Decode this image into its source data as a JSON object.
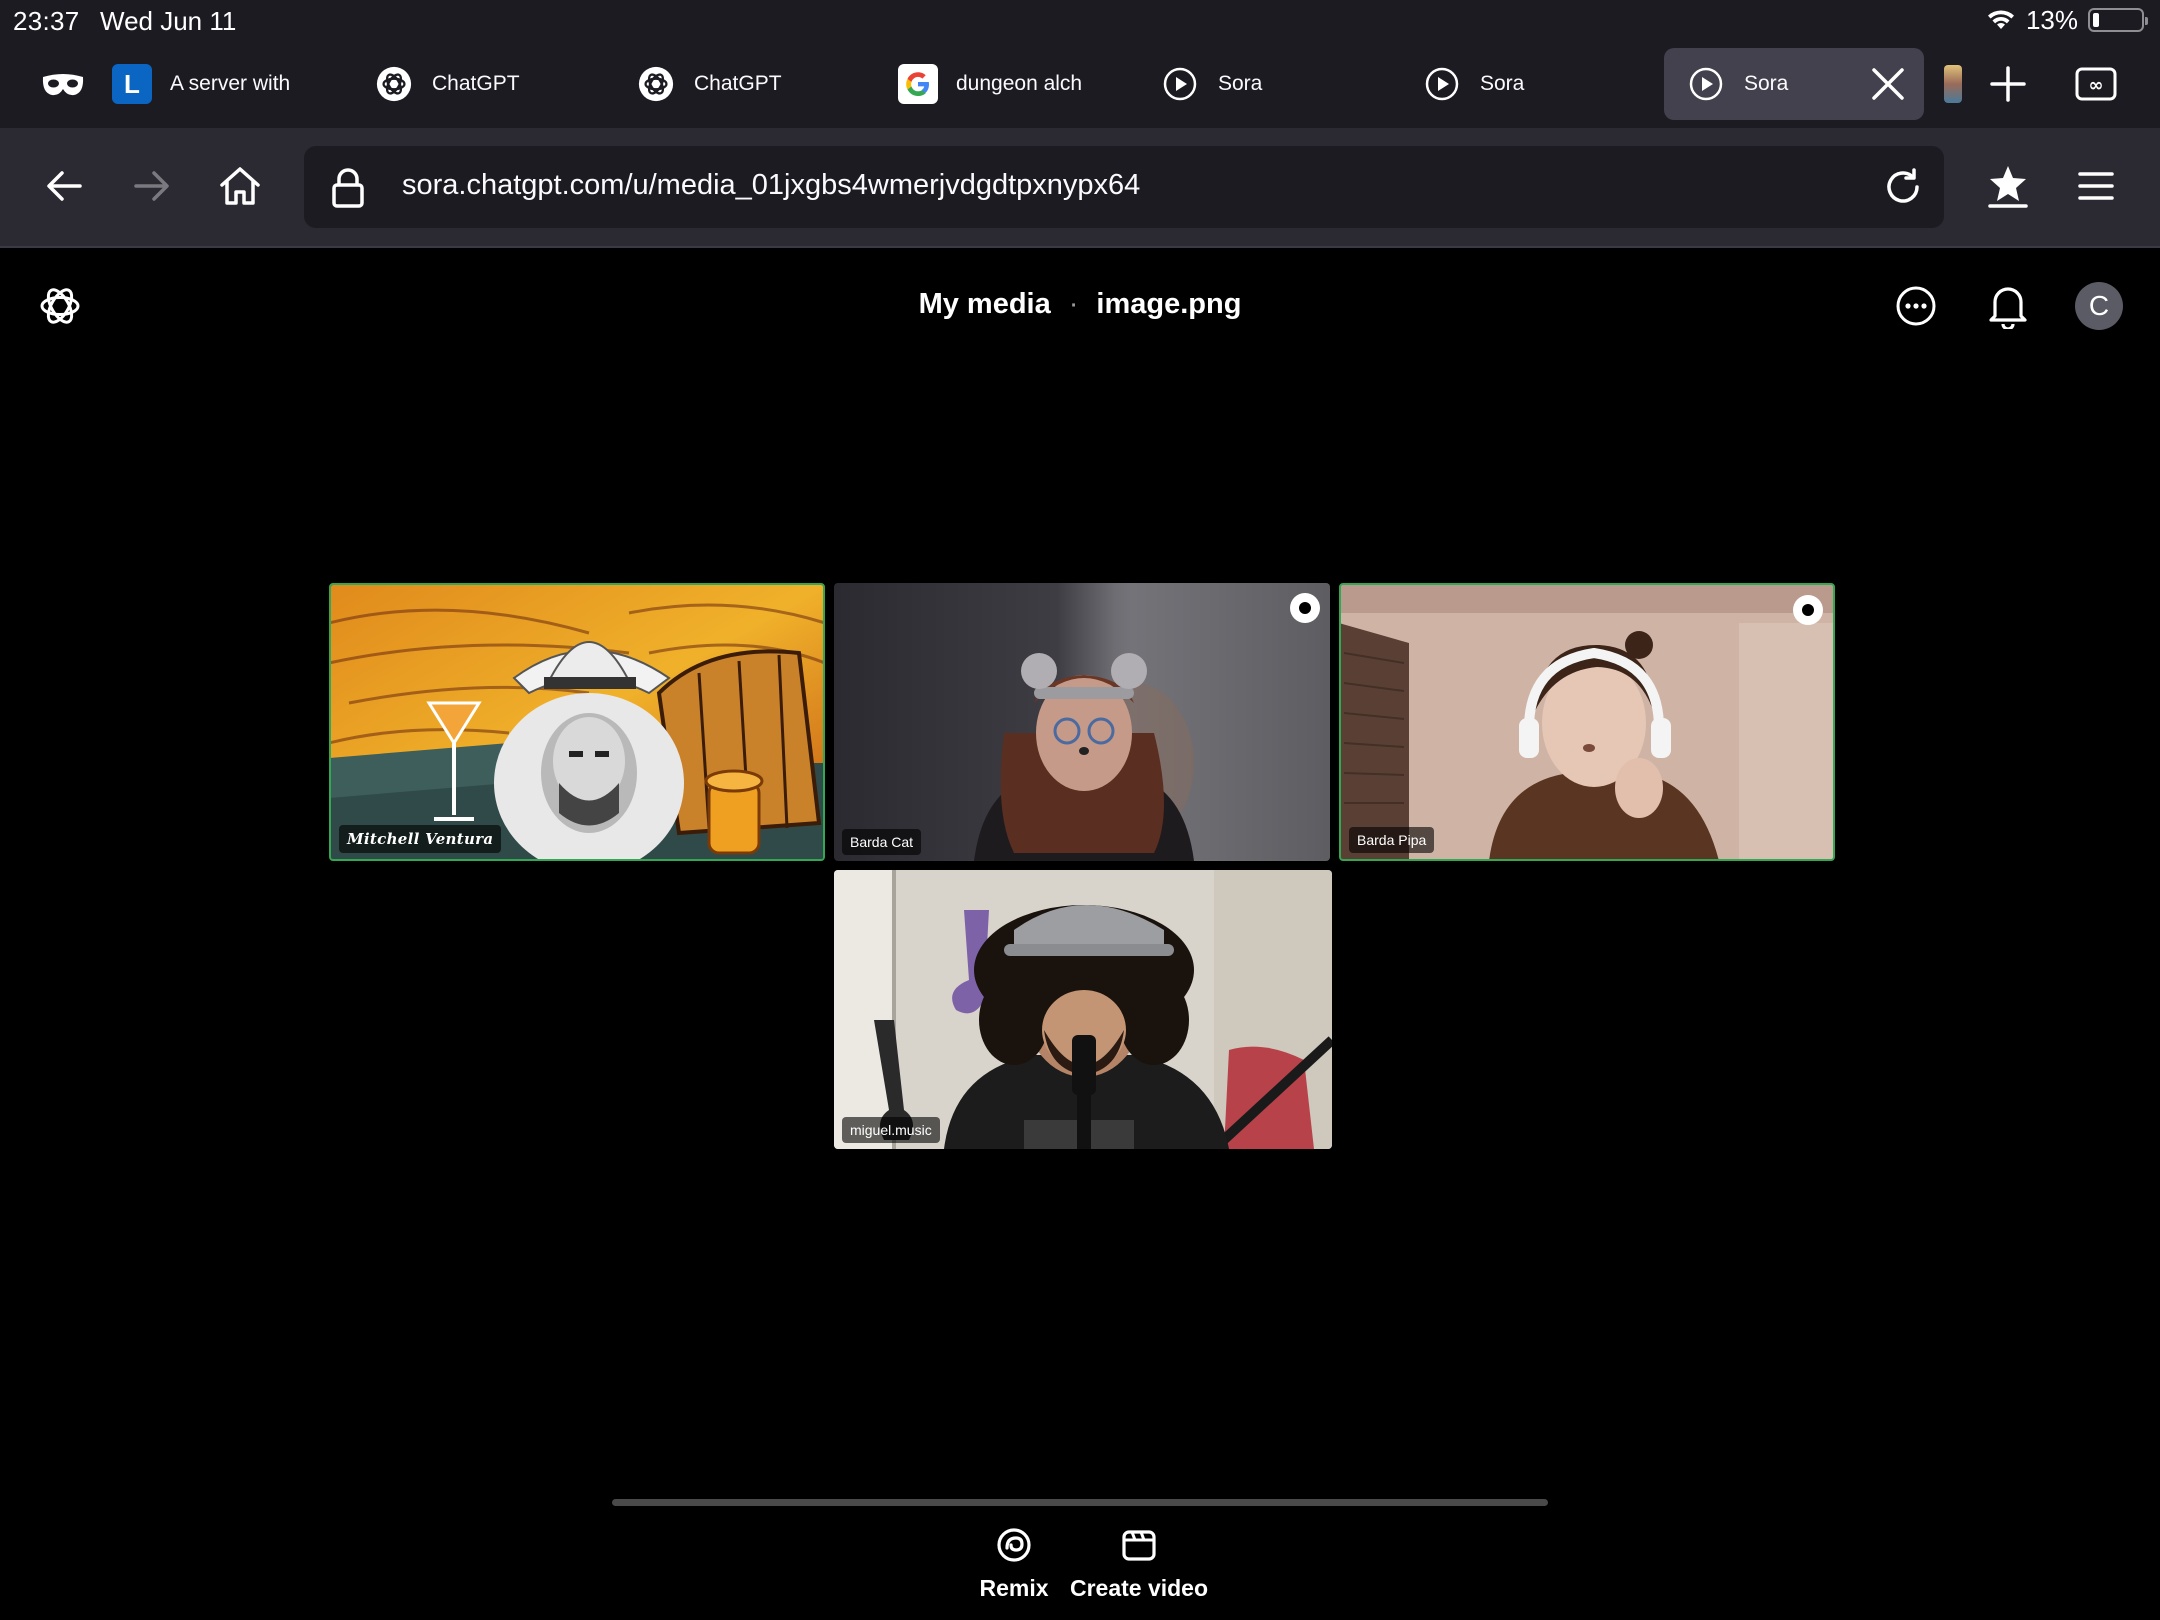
{
  "status_bar": {
    "time": "23:37",
    "date": "Wed Jun 11",
    "battery_text": "13%",
    "battery_level": 0.13
  },
  "tabs": [
    {
      "label": "",
      "icon": "private-mask-icon"
    },
    {
      "label": "A server with",
      "icon": "l-logo-icon"
    },
    {
      "label": "ChatGPT",
      "icon": "openai-logo-icon"
    },
    {
      "label": "ChatGPT",
      "icon": "openai-logo-icon"
    },
    {
      "label": "dungeon alch",
      "icon": "google-logo-icon"
    },
    {
      "label": "Sora",
      "icon": "play-circle-icon"
    },
    {
      "label": "Sora",
      "icon": "play-circle-icon"
    },
    {
      "label": "Sora",
      "icon": "play-circle-icon",
      "active": true
    }
  ],
  "toolbar": {
    "url": "sora.chatgpt.com/u/media_01jxgbs4wmerjvdgdtpxnypx64"
  },
  "page": {
    "breadcrumb_parent": "My media",
    "breadcrumb_separator": "·",
    "breadcrumb_current": "image.png",
    "avatar_initial": "C"
  },
  "participants": [
    {
      "name": "Mitchell Ventura",
      "speaking": true,
      "shield": false
    },
    {
      "name": "Barda Cat",
      "speaking": false,
      "shield": true
    },
    {
      "name": "Barda Pipa",
      "speaking": true,
      "shield": true
    },
    {
      "name": "miguel.music",
      "speaking": false,
      "shield": false
    }
  ],
  "actions": {
    "remix_label": "Remix",
    "create_video_label": "Create video"
  },
  "colors": {
    "speaking_border": "#32a852",
    "tab_strip_bg": "#1c1b22",
    "toolbar_bg": "#2b2a33"
  }
}
